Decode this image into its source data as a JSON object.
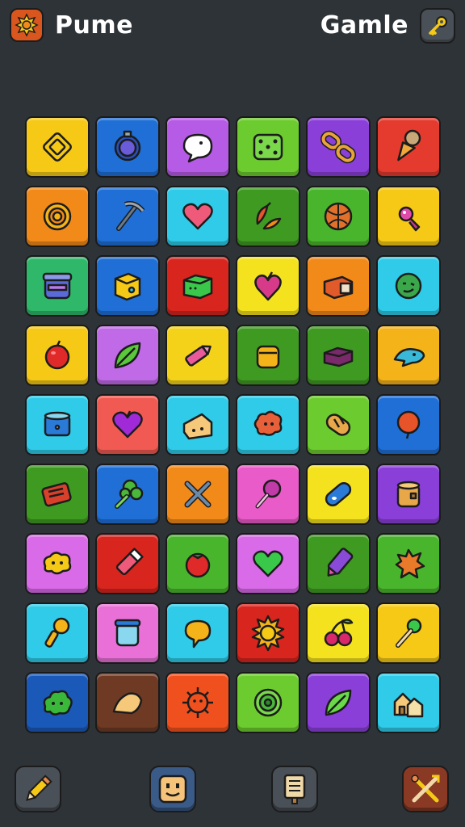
{
  "header": {
    "app_title": "Pume",
    "game_title": "Gamle",
    "logo_icon": "sun-badge-icon",
    "key_button_icon": "key-icon"
  },
  "board": {
    "rows": 9,
    "columns": 6,
    "tiles": [
      {
        "color": "#f5c916",
        "icon": "diamond-frame-icon"
      },
      {
        "color": "#1f6fd6",
        "icon": "ring-icon"
      },
      {
        "color": "#b65be6",
        "icon": "speech-bubble-icon"
      },
      {
        "color": "#6ccb2e",
        "icon": "dice-icon"
      },
      {
        "color": "#8a3fd8",
        "icon": "chain-link-icon"
      },
      {
        "color": "#e53a2e",
        "icon": "ice-cream-cone-icon"
      },
      {
        "color": "#f28a1a",
        "icon": "gold-ring-icon"
      },
      {
        "color": "#1f6fd6",
        "icon": "pickaxe-icon"
      },
      {
        "color": "#2fcbe8",
        "icon": "heart-icon"
      },
      {
        "color": "#3f9a22",
        "icon": "peppers-icon"
      },
      {
        "color": "#49b52c",
        "icon": "ball-icon"
      },
      {
        "color": "#f5c916",
        "icon": "candy-icon"
      },
      {
        "color": "#2fb86a",
        "icon": "jar-icon"
      },
      {
        "color": "#1f6fd6",
        "icon": "box-icon"
      },
      {
        "color": "#d8251e",
        "icon": "cube-icon"
      },
      {
        "color": "#f5e21f",
        "icon": "heart-fruit-icon"
      },
      {
        "color": "#f28a1a",
        "icon": "brick-icon"
      },
      {
        "color": "#2fcbe8",
        "icon": "smile-face-icon"
      },
      {
        "color": "#f5c916",
        "icon": "apple-icon"
      },
      {
        "color": "#c06ae8",
        "icon": "leaf-icon"
      },
      {
        "color": "#f5d21a",
        "icon": "crayon-icon"
      },
      {
        "color": "#3f9a22",
        "icon": "honey-pot-icon"
      },
      {
        "color": "#3f9a22",
        "icon": "chest-icon"
      },
      {
        "color": "#f5b31a",
        "icon": "fish-icon"
      },
      {
        "color": "#2fcbe8",
        "icon": "drum-icon"
      },
      {
        "color": "#f05a52",
        "icon": "purple-heart-icon"
      },
      {
        "color": "#2fcbe8",
        "icon": "cheese-icon"
      },
      {
        "color": "#2fcbe8",
        "icon": "flower-cloud-icon"
      },
      {
        "color": "#6ccb2e",
        "icon": "bread-icon"
      },
      {
        "color": "#1f6fd6",
        "icon": "balloon-icon"
      },
      {
        "color": "#3f9a22",
        "icon": "radio-icon"
      },
      {
        "color": "#1f6fd6",
        "icon": "broccoli-icon"
      },
      {
        "color": "#f28a1a",
        "icon": "crossed-sticks-icon"
      },
      {
        "color": "#e95bc8",
        "icon": "lollipop-icon"
      },
      {
        "color": "#f5e21f",
        "icon": "capsule-icon"
      },
      {
        "color": "#8a3fd8",
        "icon": "barrel-icon"
      },
      {
        "color": "#d96ae8",
        "icon": "splat-icon"
      },
      {
        "color": "#d8251e",
        "icon": "marker-icon"
      },
      {
        "color": "#49b52c",
        "icon": "tomato-icon"
      },
      {
        "color": "#d96ae8",
        "icon": "green-heart-icon"
      },
      {
        "color": "#3f9a22",
        "icon": "paint-tube-icon"
      },
      {
        "color": "#49b52c",
        "icon": "orange-splat-icon"
      },
      {
        "color": "#2fcbe8",
        "icon": "key-shape-icon"
      },
      {
        "color": "#e870d6",
        "icon": "glass-jar-icon"
      },
      {
        "color": "#2fcbe8",
        "icon": "chat-bubble-icon"
      },
      {
        "color": "#d8251e",
        "icon": "sun-icon"
      },
      {
        "color": "#f5e21f",
        "icon": "cherries-icon"
      },
      {
        "color": "#f5c916",
        "icon": "brush-icon"
      },
      {
        "color": "#1b59b8",
        "icon": "bush-icon"
      },
      {
        "color": "#6e3a24",
        "icon": "cheese-wedge-icon"
      },
      {
        "color": "#f0501e",
        "icon": "virus-icon"
      },
      {
        "color": "#6ccb2e",
        "icon": "target-icon"
      },
      {
        "color": "#8a3fd8",
        "icon": "green-leaf-icon"
      },
      {
        "color": "#2fcbe8",
        "icon": "houses-icon"
      }
    ]
  },
  "toolbar": {
    "buttons": [
      {
        "icon": "pencil-icon",
        "color": "#4a5057"
      },
      {
        "icon": "face-block-icon",
        "color": "#3a5a88"
      },
      {
        "icon": "scroll-sign-icon",
        "color": "#4a5057"
      },
      {
        "icon": "crossed-tools-icon",
        "color": "#8a3a24"
      }
    ]
  }
}
